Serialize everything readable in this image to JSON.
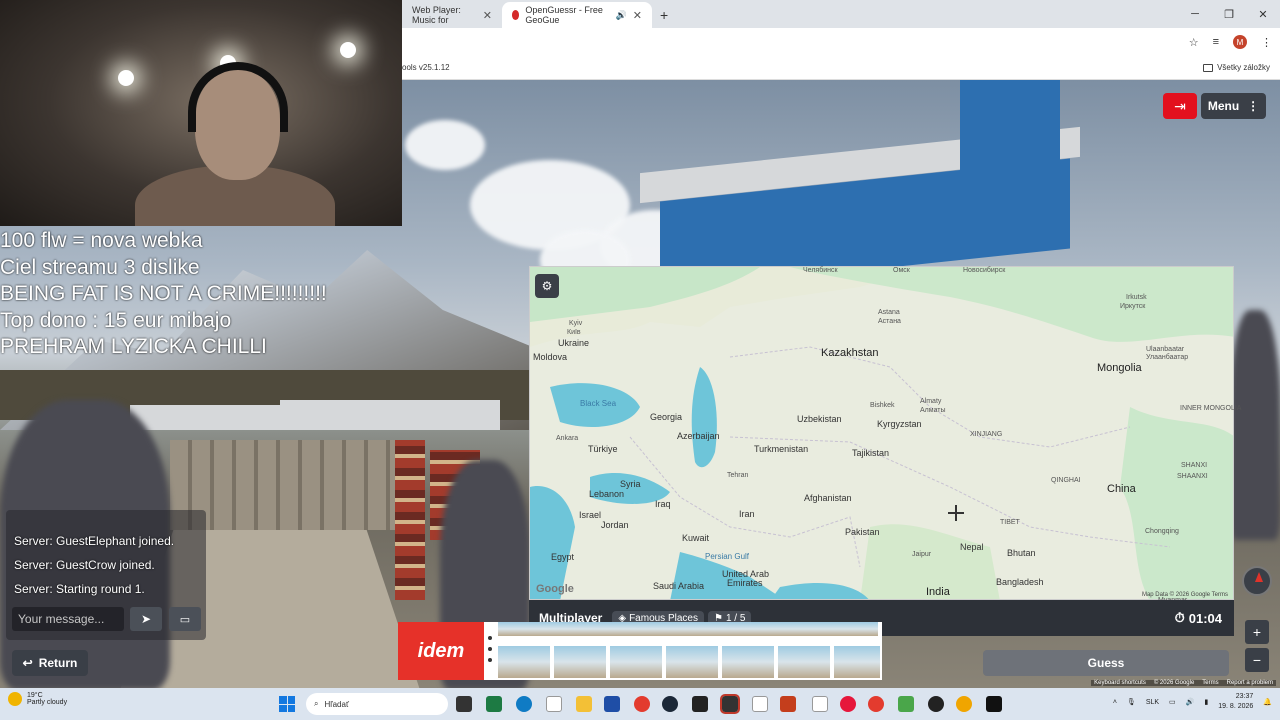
{
  "browser": {
    "tabs": [
      {
        "label": "Web Player: Music for",
        "active": false
      },
      {
        "label": "OpenGuessr - Free GeoGue",
        "active": true
      }
    ],
    "bookmarks_left": "ools v25.1.12",
    "bookmarks_right": "Všetky záložky",
    "avatar_letter": "M"
  },
  "overlay_lines": [
    "100 flw = nova webka",
    "Ciel streamu 3 dislike",
    "BEING FAT IS NOT A CRIME!!!!!!!!!",
    "Top dono : 15 eur mibajo",
    "PREHRAM LYZICKA CHILLI"
  ],
  "top_buttons": {
    "menu_label": "Menu"
  },
  "map": {
    "labels": [
      {
        "text": "Челябинск",
        "cls": "small"
      },
      {
        "text": "Омск",
        "cls": "small"
      },
      {
        "text": "Новосибирск",
        "cls": "small"
      },
      {
        "text": "Irkutsk",
        "cls": "small"
      },
      {
        "text": "Иркутск",
        "cls": "small"
      },
      {
        "text": "Kyiv",
        "cls": "small"
      },
      {
        "text": "Київ",
        "cls": "small"
      },
      {
        "text": "Ukraine",
        "cls": ""
      },
      {
        "text": "Astana",
        "cls": "small"
      },
      {
        "text": "Астана",
        "cls": "small"
      },
      {
        "text": "Kazakhstan",
        "cls": "big"
      },
      {
        "text": "Ulaanbaatar",
        "cls": "small"
      },
      {
        "text": "Улаанбаатар",
        "cls": "small"
      },
      {
        "text": "Moldova",
        "cls": ""
      },
      {
        "text": "Mongolia",
        "cls": "big"
      },
      {
        "text": "Black Sea",
        "cls": "water"
      },
      {
        "text": "Georgia",
        "cls": ""
      },
      {
        "text": "Uzbekistan",
        "cls": ""
      },
      {
        "text": "Bishkek",
        "cls": "small"
      },
      {
        "text": "Almaty",
        "cls": "small"
      },
      {
        "text": "Алматы",
        "cls": "small"
      },
      {
        "text": "Kyrgyzstan",
        "cls": ""
      },
      {
        "text": "INNER MONGOLIA",
        "cls": "small"
      },
      {
        "text": "Ankara",
        "cls": "small"
      },
      {
        "text": "Azerbaijan",
        "cls": ""
      },
      {
        "text": "XINJIANG",
        "cls": "small"
      },
      {
        "text": "Türkiye",
        "cls": ""
      },
      {
        "text": "Turkmenistan",
        "cls": ""
      },
      {
        "text": "Tajikistan",
        "cls": ""
      },
      {
        "text": "SHANXI",
        "cls": "small"
      },
      {
        "text": "SHAANXI",
        "cls": "small"
      },
      {
        "text": "QINGHAI",
        "cls": "small"
      },
      {
        "text": "Tehran",
        "cls": "small"
      },
      {
        "text": "Syria",
        "cls": ""
      },
      {
        "text": "China",
        "cls": "big"
      },
      {
        "text": "Lebanon",
        "cls": ""
      },
      {
        "text": "Afghanistan",
        "cls": ""
      },
      {
        "text": "Iraq",
        "cls": ""
      },
      {
        "text": "Iran",
        "cls": ""
      },
      {
        "text": "Israel",
        "cls": ""
      },
      {
        "text": "Jordan",
        "cls": ""
      },
      {
        "text": "TIBET",
        "cls": "small"
      },
      {
        "text": "Pakistan",
        "cls": ""
      },
      {
        "text": "Kuwait",
        "cls": ""
      },
      {
        "text": "Chongqing",
        "cls": "small"
      },
      {
        "text": "Nepal",
        "cls": ""
      },
      {
        "text": "Bhutan",
        "cls": ""
      },
      {
        "text": "Egypt",
        "cls": ""
      },
      {
        "text": "Persian Gulf",
        "cls": "water"
      },
      {
        "text": "Jaipur",
        "cls": "small"
      },
      {
        "text": "Saudi Arabia",
        "cls": ""
      },
      {
        "text": "United Arab",
        "cls": ""
      },
      {
        "text": "Emirates",
        "cls": ""
      },
      {
        "text": "Bangladesh",
        "cls": ""
      },
      {
        "text": "India",
        "cls": "big"
      },
      {
        "text": "Myanmar",
        "cls": "small"
      }
    ],
    "google": "Google",
    "attribution": "Map Data © 2026 Google   Terms"
  },
  "status": {
    "mode": "Multiplayer",
    "category": "Famous Places",
    "round": "1 / 5",
    "timer": "01:04"
  },
  "chat": {
    "messages": [
      "Server: GuestElephant joined.",
      "Server: GuestCrow joined.",
      "Server: Starting round 1."
    ],
    "placeholder": "Your message...",
    "return_label": "Return"
  },
  "ad": {
    "brand": "idem"
  },
  "guess_label": "Guess",
  "sv_attribution": [
    "Keyboard shortcuts",
    "© 2026 Google",
    "Terms",
    "Report a problem"
  ],
  "taskbar": {
    "temp": "19°C",
    "weather": "Partly cloudy",
    "search": "Hľadať",
    "lang": "SLK",
    "time": "23:37",
    "date": "19. 8. 2026"
  },
  "colors": {
    "accent_red": "#e3101e",
    "panel": "#2d3138",
    "map_bg": "#e8ebd9"
  }
}
